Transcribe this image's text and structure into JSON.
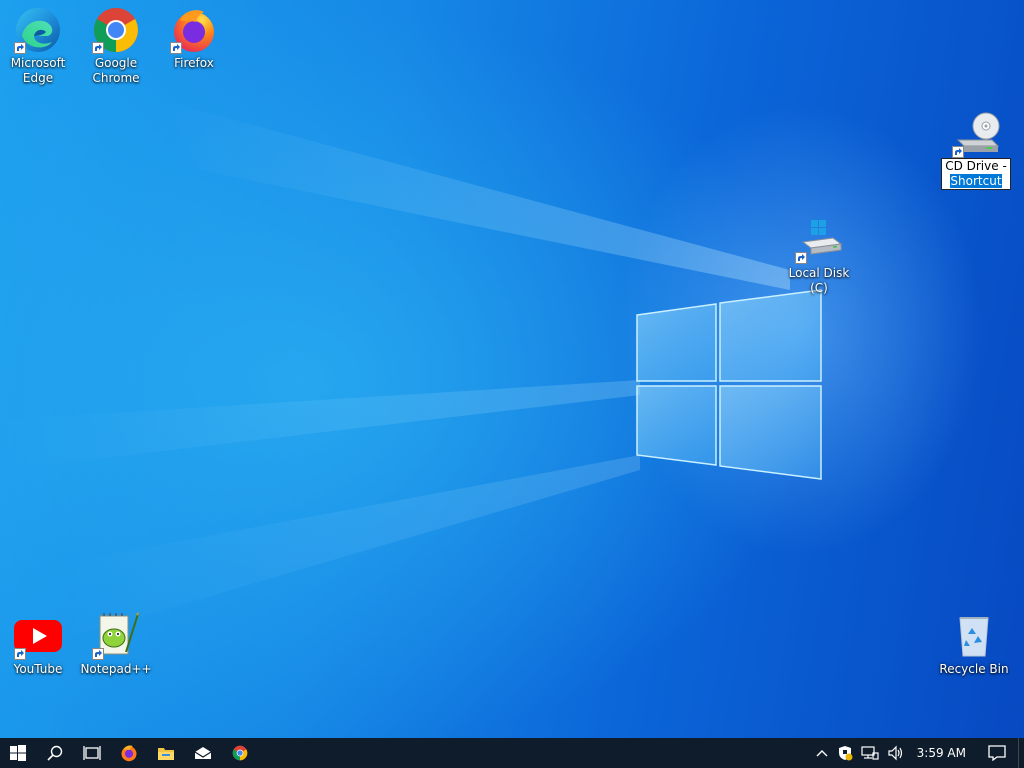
{
  "desktop": {
    "icons": {
      "edge": {
        "label": "Microsoft Edge",
        "icon": "edge-icon"
      },
      "chrome": {
        "label": "Google Chrome",
        "icon": "chrome-icon"
      },
      "firefox": {
        "label": "Firefox",
        "icon": "firefox-icon"
      },
      "cd_drive": {
        "label_main": "CD Drive -",
        "label_selected": "Shortcut",
        "icon": "cd-drive-icon"
      },
      "local_disk": {
        "label": "Local Disk (C)",
        "icon": "hard-drive-icon"
      },
      "youtube": {
        "label": "YouTube",
        "icon": "youtube-icon"
      },
      "notepadpp": {
        "label": "Notepad++",
        "icon": "notepadpp-icon"
      },
      "recycle_bin": {
        "label": "Recycle Bin",
        "icon": "recycle-bin-icon"
      }
    }
  },
  "taskbar": {
    "pinned": [
      "start-icon",
      "search-icon",
      "task-view-icon",
      "firefox-icon",
      "file-explorer-icon",
      "mail-icon",
      "chrome-icon"
    ],
    "tray": {
      "icons": [
        "chevron-up-icon",
        "security-icon",
        "network-icon",
        "volume-icon"
      ],
      "clock": "3:59 AM",
      "notification_icon": "action-center-icon"
    }
  },
  "colors": {
    "taskbar_bg": "#0f1c2b",
    "accent": "#0078d7"
  }
}
